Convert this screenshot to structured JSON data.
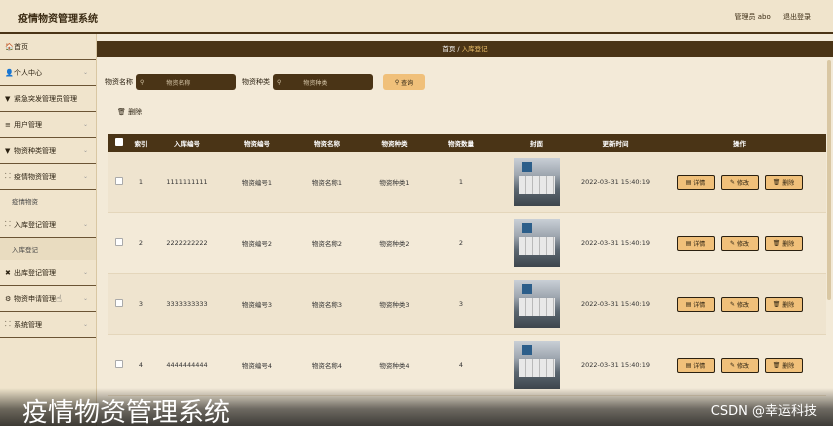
{
  "app_title": "疫情物资管理系统",
  "topbar": {
    "admin": "管理员 abo",
    "logout": "退出登录"
  },
  "sidebar": {
    "items": [
      {
        "icon": "🏠",
        "label": "首页",
        "chev": ""
      },
      {
        "icon": "👤",
        "label": "个人中心",
        "chev": "⌄"
      },
      {
        "icon": "▼",
        "label": "紧急突发管理员管理",
        "chev": ""
      },
      {
        "icon": "≡",
        "label": "用户管理",
        "chev": "⌄"
      },
      {
        "icon": "▼",
        "label": "物资种类管理",
        "chev": "⌄"
      },
      {
        "icon": "⸬",
        "label": "疫情物资管理",
        "chev": "⌄"
      },
      {
        "icon": "",
        "label": "疫情物资",
        "chev": ""
      },
      {
        "icon": "⸬",
        "label": "入库登记管理",
        "chev": "⌄"
      },
      {
        "icon": "",
        "label": "入库登记",
        "chev": ""
      },
      {
        "icon": "✖",
        "label": "出库登记管理",
        "chev": "⌄"
      },
      {
        "icon": "⚙",
        "label": "物资申请管理",
        "chev": "⌄"
      },
      {
        "icon": "⸬",
        "label": "系统管理",
        "chev": "⌄"
      }
    ]
  },
  "breadcrumb": {
    "home": "首页",
    "sep": "/",
    "current": "入库登记"
  },
  "search": {
    "name_label": "物资名称",
    "name_placeholder": "物资名称",
    "type_label": "物资种类",
    "type_placeholder": "物资种类",
    "button": "查询"
  },
  "delete_button": "删除",
  "table": {
    "headers": [
      "索引",
      "入库编号",
      "物资编号",
      "物资名称",
      "物资种类",
      "物资数量",
      "封面",
      "更新时间",
      "操作"
    ],
    "rows": [
      {
        "index": "1",
        "in_no": "1111111111",
        "item_no": "物资编号1",
        "name": "物资名称1",
        "type": "物资种类1",
        "qty": "1",
        "time": "2022-03-31 15:40:19"
      },
      {
        "index": "2",
        "in_no": "2222222222",
        "item_no": "物资编号2",
        "name": "物资名称2",
        "type": "物资种类2",
        "qty": "2",
        "time": "2022-03-31 15:40:19"
      },
      {
        "index": "3",
        "in_no": "3333333333",
        "item_no": "物资编号3",
        "name": "物资名称3",
        "type": "物资种类3",
        "qty": "3",
        "time": "2022-03-31 15:40:19"
      },
      {
        "index": "4",
        "in_no": "4444444444",
        "item_no": "物资编号4",
        "name": "物资名称4",
        "type": "物资种类4",
        "qty": "4",
        "time": "2022-03-31 15:40:19"
      }
    ],
    "actions": {
      "detail": "详情",
      "edit": "修改",
      "delete": "删除"
    }
  },
  "overlay_title": "疫情物资管理系统",
  "watermark": "CSDN @幸运科技",
  "colors": {
    "accent_dark": "#4a3416",
    "button": "#f0c07a",
    "background": "#f3ead8"
  }
}
